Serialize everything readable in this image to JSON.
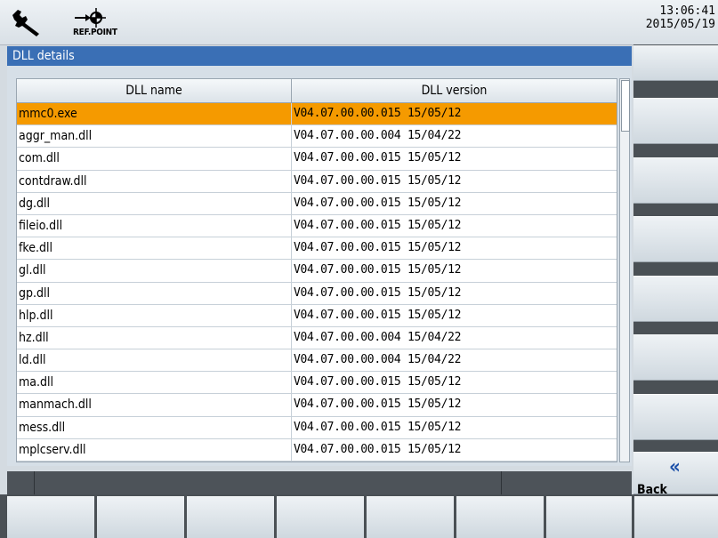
{
  "header": {
    "tool_icon": "wrench-icon",
    "refpoint_icon": "reference-point-icon",
    "refpoint_label": "REF.POINT",
    "time": "13:06:41",
    "date": "2015/05/19"
  },
  "dialog": {
    "title": "DLL details",
    "columns": [
      "DLL name",
      "DLL version"
    ],
    "selected_row": 0,
    "rows": [
      {
        "name": "mmc0.exe",
        "version": "V04.07.00.00.015 15/05/12"
      },
      {
        "name": "aggr_man.dll",
        "version": "V04.07.00.00.004 15/04/22"
      },
      {
        "name": "com.dll",
        "version": "V04.07.00.00.015 15/05/12"
      },
      {
        "name": "contdraw.dll",
        "version": "V04.07.00.00.015 15/05/12"
      },
      {
        "name": "dg.dll",
        "version": "V04.07.00.00.015 15/05/12"
      },
      {
        "name": "fileio.dll",
        "version": "V04.07.00.00.015 15/05/12"
      },
      {
        "name": "fke.dll",
        "version": "V04.07.00.00.015 15/05/12"
      },
      {
        "name": "gl.dll",
        "version": "V04.07.00.00.015 15/05/12"
      },
      {
        "name": "gp.dll",
        "version": "V04.07.00.00.015 15/05/12"
      },
      {
        "name": "hlp.dll",
        "version": "V04.07.00.00.015 15/05/12"
      },
      {
        "name": "hz.dll",
        "version": "V04.07.00.00.004 15/04/22"
      },
      {
        "name": "ld.dll",
        "version": "V04.07.00.00.004 15/04/22"
      },
      {
        "name": "ma.dll",
        "version": "V04.07.00.00.015 15/05/12"
      },
      {
        "name": "manmach.dll",
        "version": "V04.07.00.00.015 15/05/12"
      },
      {
        "name": "mess.dll",
        "version": "V04.07.00.00.015 15/05/12"
      },
      {
        "name": "mplcserv.dll",
        "version": "V04.07.00.00.015 15/05/12"
      }
    ]
  },
  "softkeys": {
    "back_icon": "double-chevron-left-icon",
    "back_label": "Back"
  },
  "colors": {
    "title_bar": "#3a6fb5",
    "selection": "#f59a00",
    "back_chevron": "#1a4fa8"
  }
}
